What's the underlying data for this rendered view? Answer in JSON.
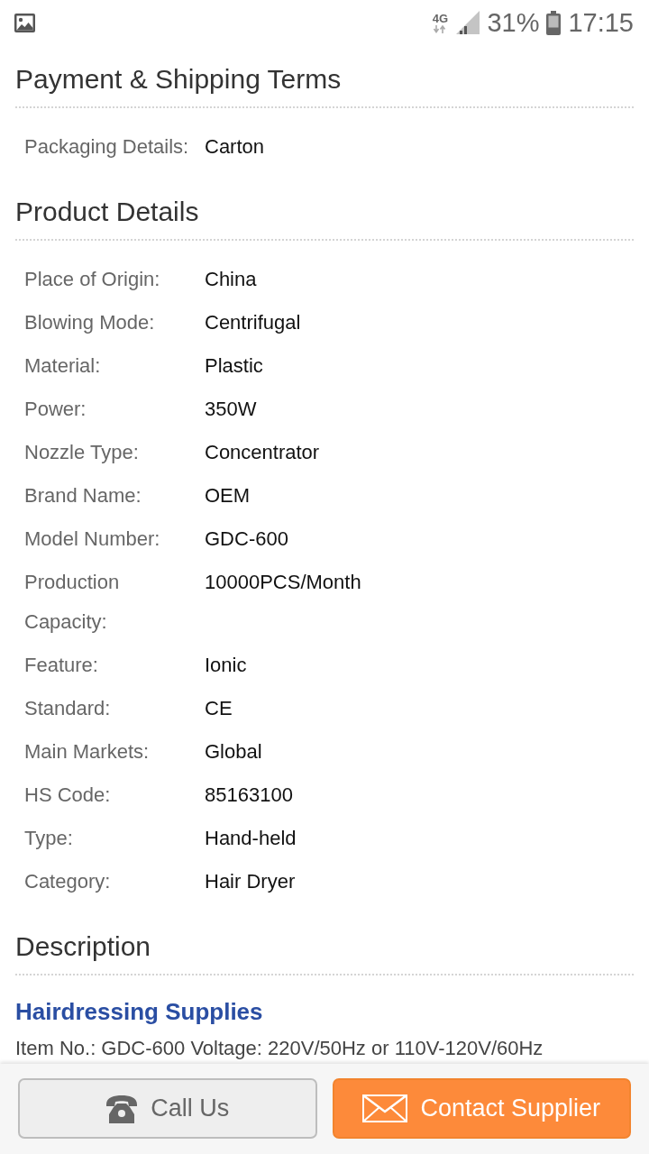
{
  "status_bar": {
    "network_type": "4G",
    "battery_percent": "31%",
    "time": "17:15"
  },
  "sections": [
    {
      "title": "Payment & Shipping Terms",
      "rows": [
        {
          "label": "Packaging Details:",
          "value": "Carton"
        }
      ]
    },
    {
      "title": "Product Details",
      "rows": [
        {
          "label": "Place of Origin:",
          "value": "China"
        },
        {
          "label": "Blowing Mode:",
          "value": "Centrifugal"
        },
        {
          "label": "Material:",
          "value": "Plastic"
        },
        {
          "label": "Power:",
          "value": "350W"
        },
        {
          "label": "Nozzle Type:",
          "value": "Concentrator"
        },
        {
          "label": "Brand Name:",
          "value": "OEM"
        },
        {
          "label": "Model Number:",
          "value": "GDC-600"
        },
        {
          "label": "Production Capacity:",
          "value": "10000PCS/Month"
        },
        {
          "label": "Feature:",
          "value": "Ionic"
        },
        {
          "label": "Standard:",
          "value": "CE"
        },
        {
          "label": "Main Markets:",
          "value": "Global"
        },
        {
          "label": "HS Code:",
          "value": "85163100"
        },
        {
          "label": "Type:",
          "value": "Hand-held"
        },
        {
          "label": "Category:",
          "value": "Hair Dryer"
        }
      ]
    }
  ],
  "description": {
    "title": "Description",
    "heading": "Hairdressing Supplies",
    "text": "Item No.: GDC-600 Voltage: 220V/50Hz or 110V-120V/60Hz"
  },
  "actions": [
    {
      "kind": "call",
      "label": "Call Us"
    },
    {
      "kind": "contact",
      "label": "Contact Supplier"
    }
  ]
}
